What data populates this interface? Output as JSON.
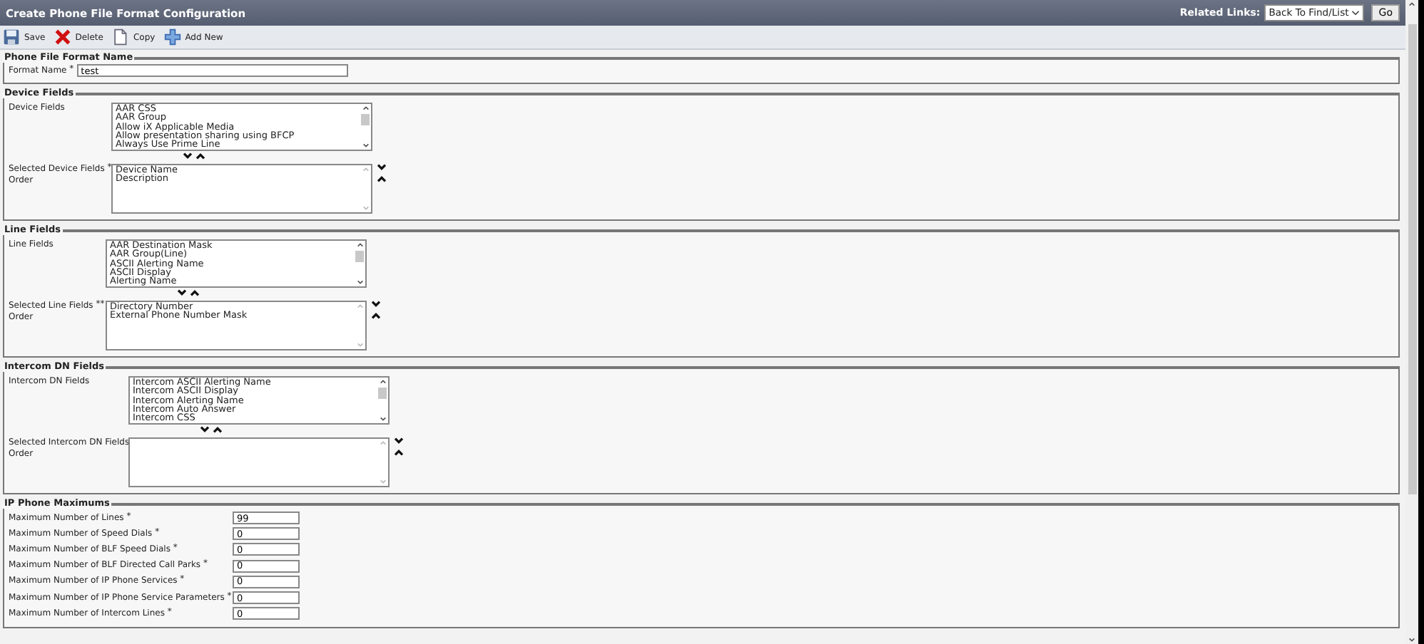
{
  "header": {
    "title": "Create Phone File Format Configuration",
    "related_label": "Related Links:",
    "related_value": "Back To Find/List",
    "go": "Go"
  },
  "toolbar": [
    {
      "kind": "save",
      "label": "Save"
    },
    {
      "kind": "delete",
      "label": "Delete"
    },
    {
      "kind": "copy",
      "label": "Copy"
    },
    {
      "kind": "add",
      "label": "Add New"
    }
  ],
  "sections": [
    {
      "kind": "name",
      "legend": "Phone File Format Name",
      "label": "Format Name",
      "required": "*",
      "value": "test"
    },
    {
      "kind": "lists",
      "legend": "Device Fields",
      "available_label": "Device Fields",
      "available": [
        "AAR CSS",
        "AAR Group",
        "Allow iX Applicable Media",
        "Allow presentation sharing using BFCP",
        "Always Use Prime Line"
      ],
      "selected_label": [
        "Selected Device Fields",
        "Order"
      ],
      "required": "*",
      "selected": [
        "Device Name",
        "Description"
      ]
    },
    {
      "kind": "lists",
      "legend": "Line Fields",
      "available_label": "Line Fields",
      "available": [
        "AAR Destination Mask",
        "AAR Group(Line)",
        "ASCII Alerting Name",
        "ASCII Display",
        "Alerting Name"
      ],
      "selected_label": [
        "Selected Line Fields",
        "Order"
      ],
      "required": "**",
      "selected": [
        "Directory Number",
        "External Phone Number Mask"
      ]
    },
    {
      "kind": "lists",
      "legend": "Intercom DN Fields",
      "available_label": "Intercom DN Fields",
      "available": [
        "Intercom ASCII Alerting Name",
        "Intercom ASCII Display",
        "Intercom Alerting Name",
        "Intercom Auto Answer",
        "Intercom CSS"
      ],
      "selected_label": [
        "Selected Intercom DN Fields",
        "Order"
      ]
    },
    {
      "kind": "maximums",
      "legend": "IP Phone Maximums",
      "fields": [
        {
          "label": "Maximum Number of Lines",
          "required": "*",
          "value": "99"
        },
        {
          "label": "Maximum Number of Speed Dials",
          "required": "*",
          "value": "0"
        },
        {
          "label": "Maximum Number of BLF Speed Dials",
          "required": "*",
          "value": "0"
        },
        {
          "label": "Maximum Number of BLF Directed Call Parks",
          "required": "*",
          "value": "0"
        },
        {
          "label": "Maximum Number of IP Phone Services",
          "required": "*",
          "value": "0"
        },
        {
          "label": "Maximum Number of IP Phone Service Parameters",
          "required": "*",
          "value": "0"
        },
        {
          "label": "Maximum Number of Intercom Lines",
          "required": "*",
          "value": "0"
        }
      ]
    }
  ]
}
